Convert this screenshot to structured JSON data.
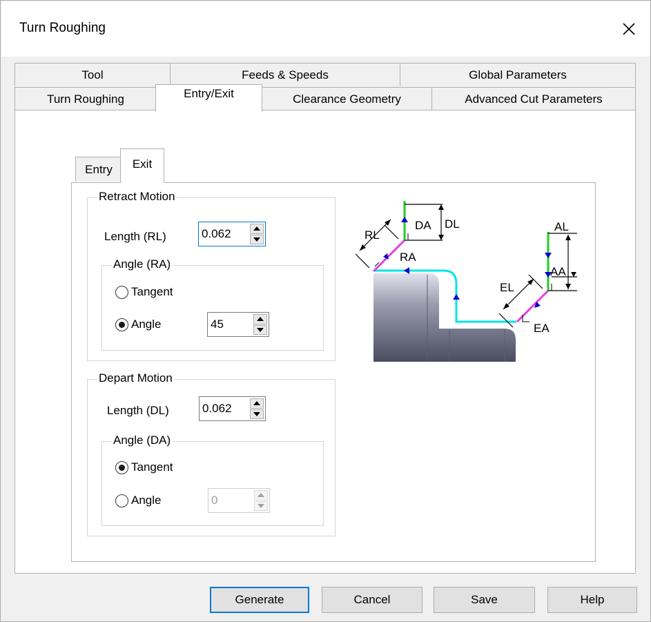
{
  "window": {
    "title": "Turn Roughing",
    "close_icon": "close-icon"
  },
  "tabs": {
    "row1": [
      "Tool",
      "Feeds & Speeds",
      "Global Parameters"
    ],
    "row2": [
      "Turn Roughing",
      "Entry/Exit",
      "Clearance Geometry",
      "Advanced Cut Parameters"
    ],
    "active": "Entry/Exit"
  },
  "inner_tabs": {
    "items": [
      "Entry",
      "Exit"
    ],
    "active": "Exit"
  },
  "retract": {
    "legend": "Retract Motion",
    "length_label": "Length (RL)",
    "length_value": "0.062",
    "angle_group": "Angle (RA)",
    "tangent_label": "Tangent",
    "angle_label": "Angle",
    "angle_value": "45",
    "selected": "Angle"
  },
  "depart": {
    "legend": "Depart Motion",
    "length_label": "Length (DL)",
    "length_value": "0.062",
    "angle_group": "Angle (DA)",
    "tangent_label": "Tangent",
    "angle_label": "Angle",
    "angle_value": "0",
    "selected": "Tangent"
  },
  "diagram": {
    "labels": {
      "rl": "RL",
      "ra": "RA",
      "da": "DA",
      "dl": "DL",
      "al": "AL",
      "aa": "AA",
      "el": "EL",
      "ea": "EA"
    },
    "colors": {
      "path": "#00e5e5",
      "retract": "#e040e0",
      "depart": "#22cc22",
      "arrow": "#0000cc"
    }
  },
  "buttons": {
    "generate": "Generate",
    "cancel": "Cancel",
    "save": "Save",
    "help": "Help"
  }
}
